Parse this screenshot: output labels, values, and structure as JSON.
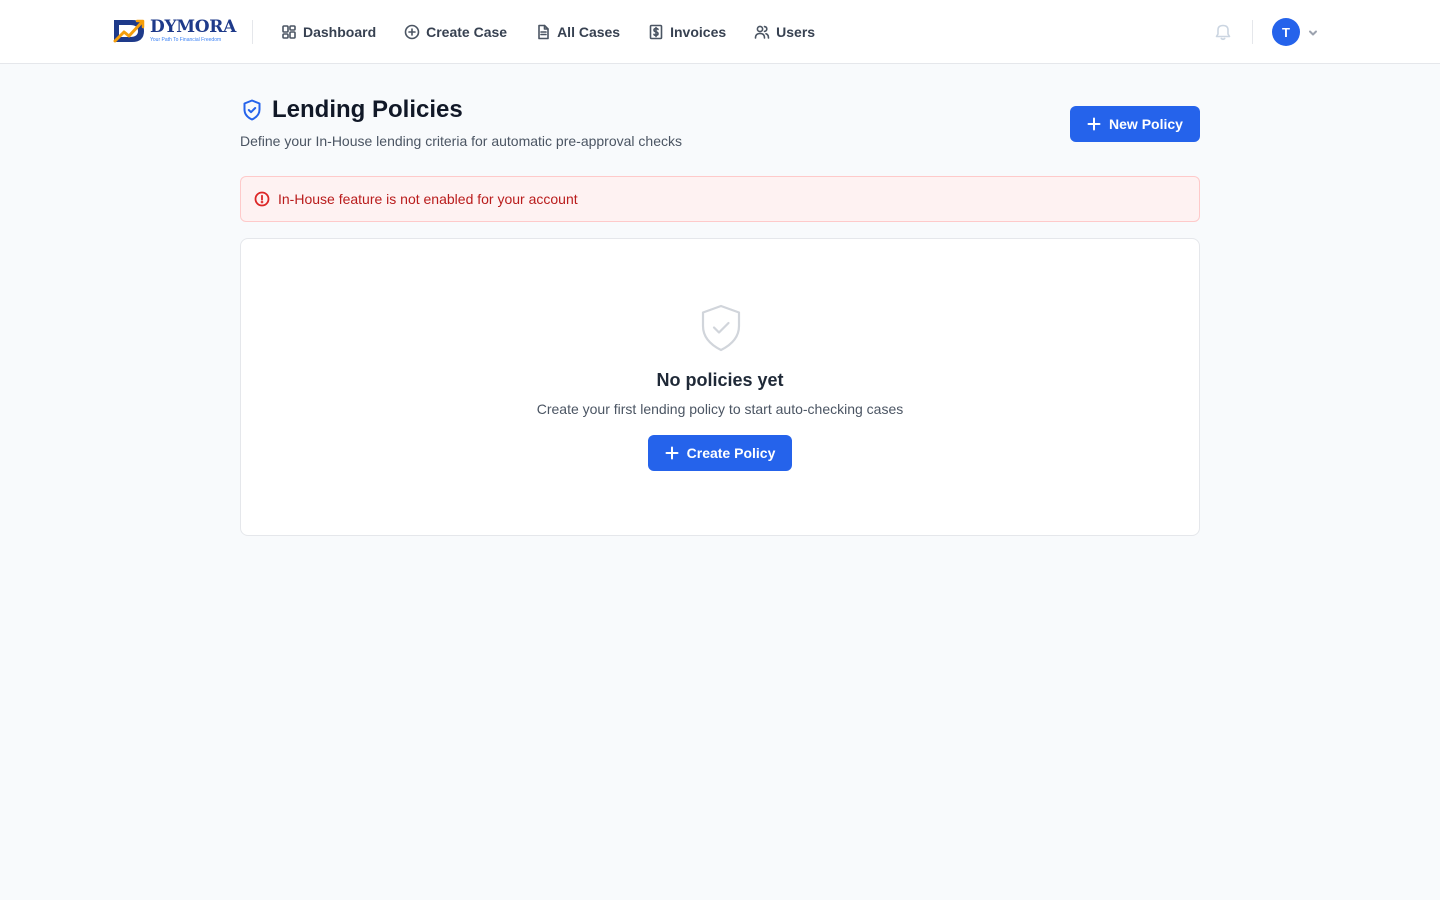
{
  "brand": {
    "name": "DYMORA",
    "tagline": "Your Path To Financial Freedom"
  },
  "nav": {
    "items": [
      {
        "label": "Dashboard",
        "icon": "grid-icon"
      },
      {
        "label": "Create Case",
        "icon": "plus-circle-icon"
      },
      {
        "label": "All Cases",
        "icon": "file-icon"
      },
      {
        "label": "Invoices",
        "icon": "dollar-doc-icon"
      },
      {
        "label": "Users",
        "icon": "users-icon"
      }
    ]
  },
  "user": {
    "initial": "T"
  },
  "header": {
    "title": "Lending Policies",
    "subtitle": "Define your In-House lending criteria for automatic pre-approval checks",
    "new_policy_label": "New Policy"
  },
  "alert": {
    "message": "In-House feature is not enabled for your account"
  },
  "empty_state": {
    "title": "No policies yet",
    "description": "Create your first lending policy to start auto-checking cases",
    "cta_label": "Create Policy"
  },
  "colors": {
    "primary": "#2563eb",
    "error_bg": "#fef2f2",
    "error_text": "#b91c1c",
    "page_bg": "#f8fafc"
  }
}
